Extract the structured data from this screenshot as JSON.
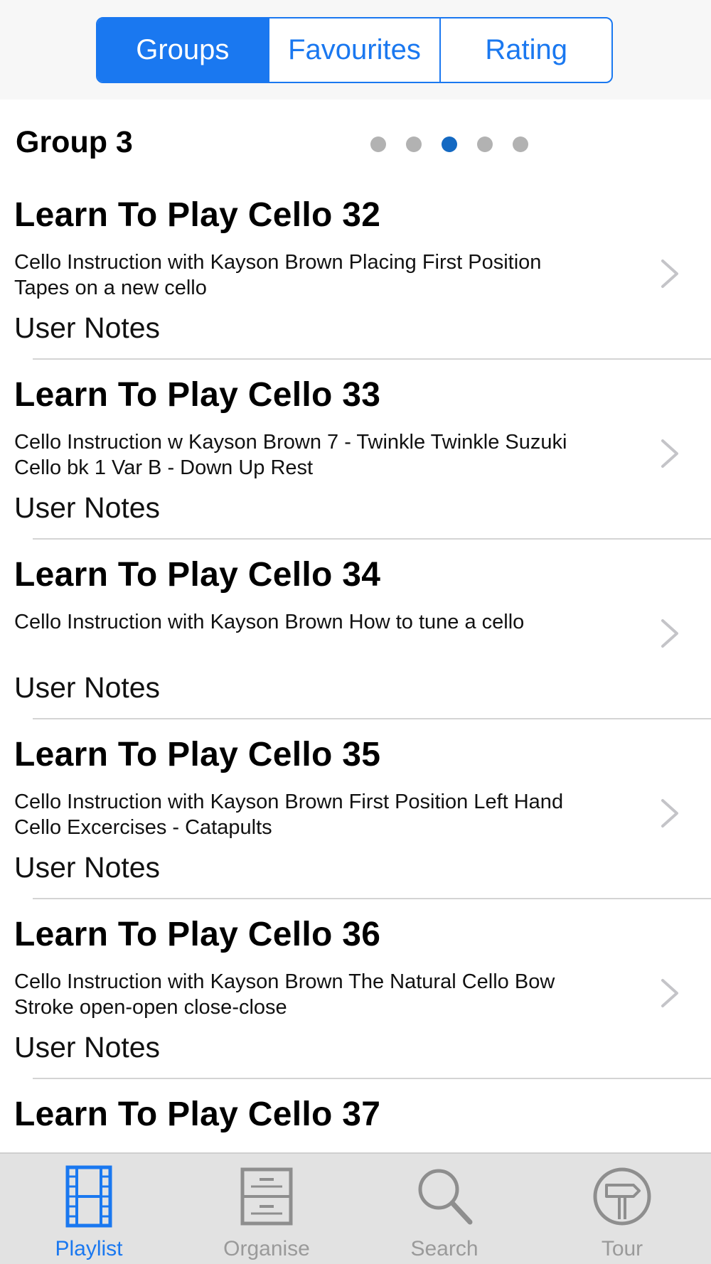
{
  "segmented": {
    "tabs": [
      {
        "label": "Groups",
        "active": true
      },
      {
        "label": "Favourites",
        "active": false
      },
      {
        "label": "Rating",
        "active": false
      }
    ]
  },
  "group": {
    "title": "Group 3",
    "page_count": 5,
    "current_page": 3
  },
  "items": [
    {
      "title": "Learn To Play Cello 32",
      "description": "Cello Instruction with Kayson Brown Placing First Position Tapes on a new cello",
      "notes": "User Notes"
    },
    {
      "title": "Learn To Play Cello 33",
      "description": "Cello Instruction w Kayson Brown 7 - Twinkle Twinkle Suzuki Cello bk 1 Var B - Down Up Rest",
      "notes": "User Notes"
    },
    {
      "title": "Learn To Play Cello 34",
      "description": "Cello Instruction with Kayson Brown How to tune a cello",
      "notes": "User Notes"
    },
    {
      "title": "Learn To Play Cello 35",
      "description": "Cello Instruction with Kayson Brown First Position Left Hand Cello Excercises - Catapults",
      "notes": "User Notes"
    },
    {
      "title": "Learn To Play Cello 36",
      "description": "Cello Instruction with Kayson Brown The Natural Cello Bow Stroke open-open close-close",
      "notes": "User Notes"
    },
    {
      "title": "Learn To Play Cello 37"
    }
  ],
  "tabbar": {
    "tabs": [
      {
        "label": "Playlist",
        "icon": "film-strip-icon",
        "active": true
      },
      {
        "label": "Organise",
        "icon": "filing-cabinet-icon",
        "active": false
      },
      {
        "label": "Search",
        "icon": "magnifier-icon",
        "active": false
      },
      {
        "label": "Tour",
        "icon": "signpost-icon",
        "active": false
      }
    ]
  },
  "colors": {
    "accent": "#1a78f0",
    "dot_active": "#1469c2",
    "dot_inactive": "#b2b2b2",
    "tab_inactive": "#9a9a9a"
  }
}
